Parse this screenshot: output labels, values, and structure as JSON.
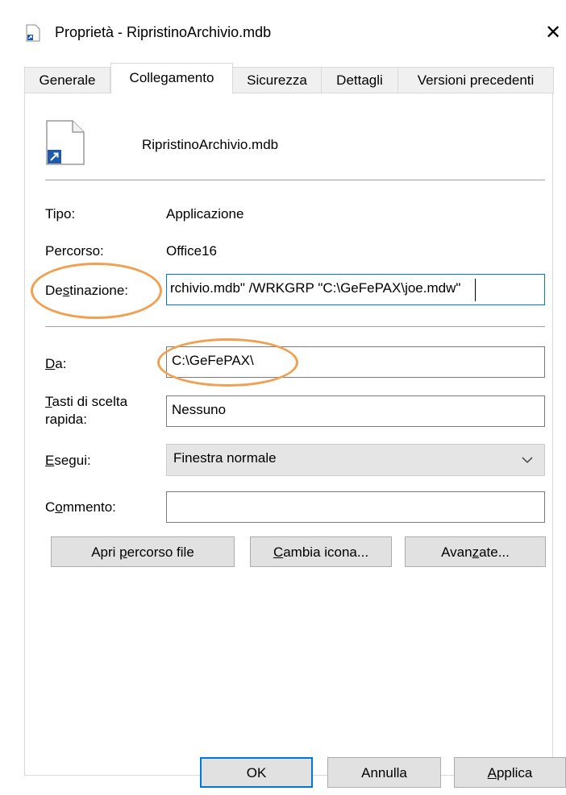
{
  "window": {
    "title": "Proprietà - RipristinoArchivio.mdb",
    "close_glyph": "✕"
  },
  "tabs": [
    {
      "label": "Generale"
    },
    {
      "label": "Collegamento"
    },
    {
      "label": "Sicurezza"
    },
    {
      "label": "Dettagli"
    },
    {
      "label": "Versioni precedenti"
    }
  ],
  "file": {
    "name": "RipristinoArchivio.mdb"
  },
  "info": {
    "tipo_label": "Tipo:",
    "tipo_value": "Applicazione",
    "percorso_label": "Percorso:",
    "percorso_value": "Office16"
  },
  "destinazione": {
    "label_prefix": "De",
    "label_accel": "s",
    "label_suffix": "tinazione:",
    "value": "rchivio.mdb\" /WRKGRP \"C:\\GeFePAX\\joe.mdw\""
  },
  "da": {
    "label_accel": "D",
    "label_suffix": "a:",
    "value": "C:\\GeFePAX\\"
  },
  "tasti": {
    "label_accel": "T",
    "label_line1_suffix": "asti di scelta",
    "label_line2": "rapida:",
    "value": "Nessuno"
  },
  "esegui": {
    "label_accel": "E",
    "label_suffix": "segui:",
    "value": "Finestra normale"
  },
  "commento": {
    "label_prefix": "C",
    "label_accel": "o",
    "label_suffix": "mmento:",
    "value": ""
  },
  "action_buttons": {
    "apri_prefix": "Apri ",
    "apri_accel": "p",
    "apri_suffix": "ercorso file",
    "cambia_accel": "C",
    "cambia_suffix": "ambia icona...",
    "avanzate_prefix": "Avan",
    "avanzate_accel": "z",
    "avanzate_suffix": "ate..."
  },
  "footer": {
    "ok_label": "OK",
    "annulla_label": "Annulla",
    "applica_accel": "A",
    "applica_suffix": "pplica"
  },
  "colors": {
    "annotation": "#f0a050",
    "focus_border": "#0078d7"
  }
}
